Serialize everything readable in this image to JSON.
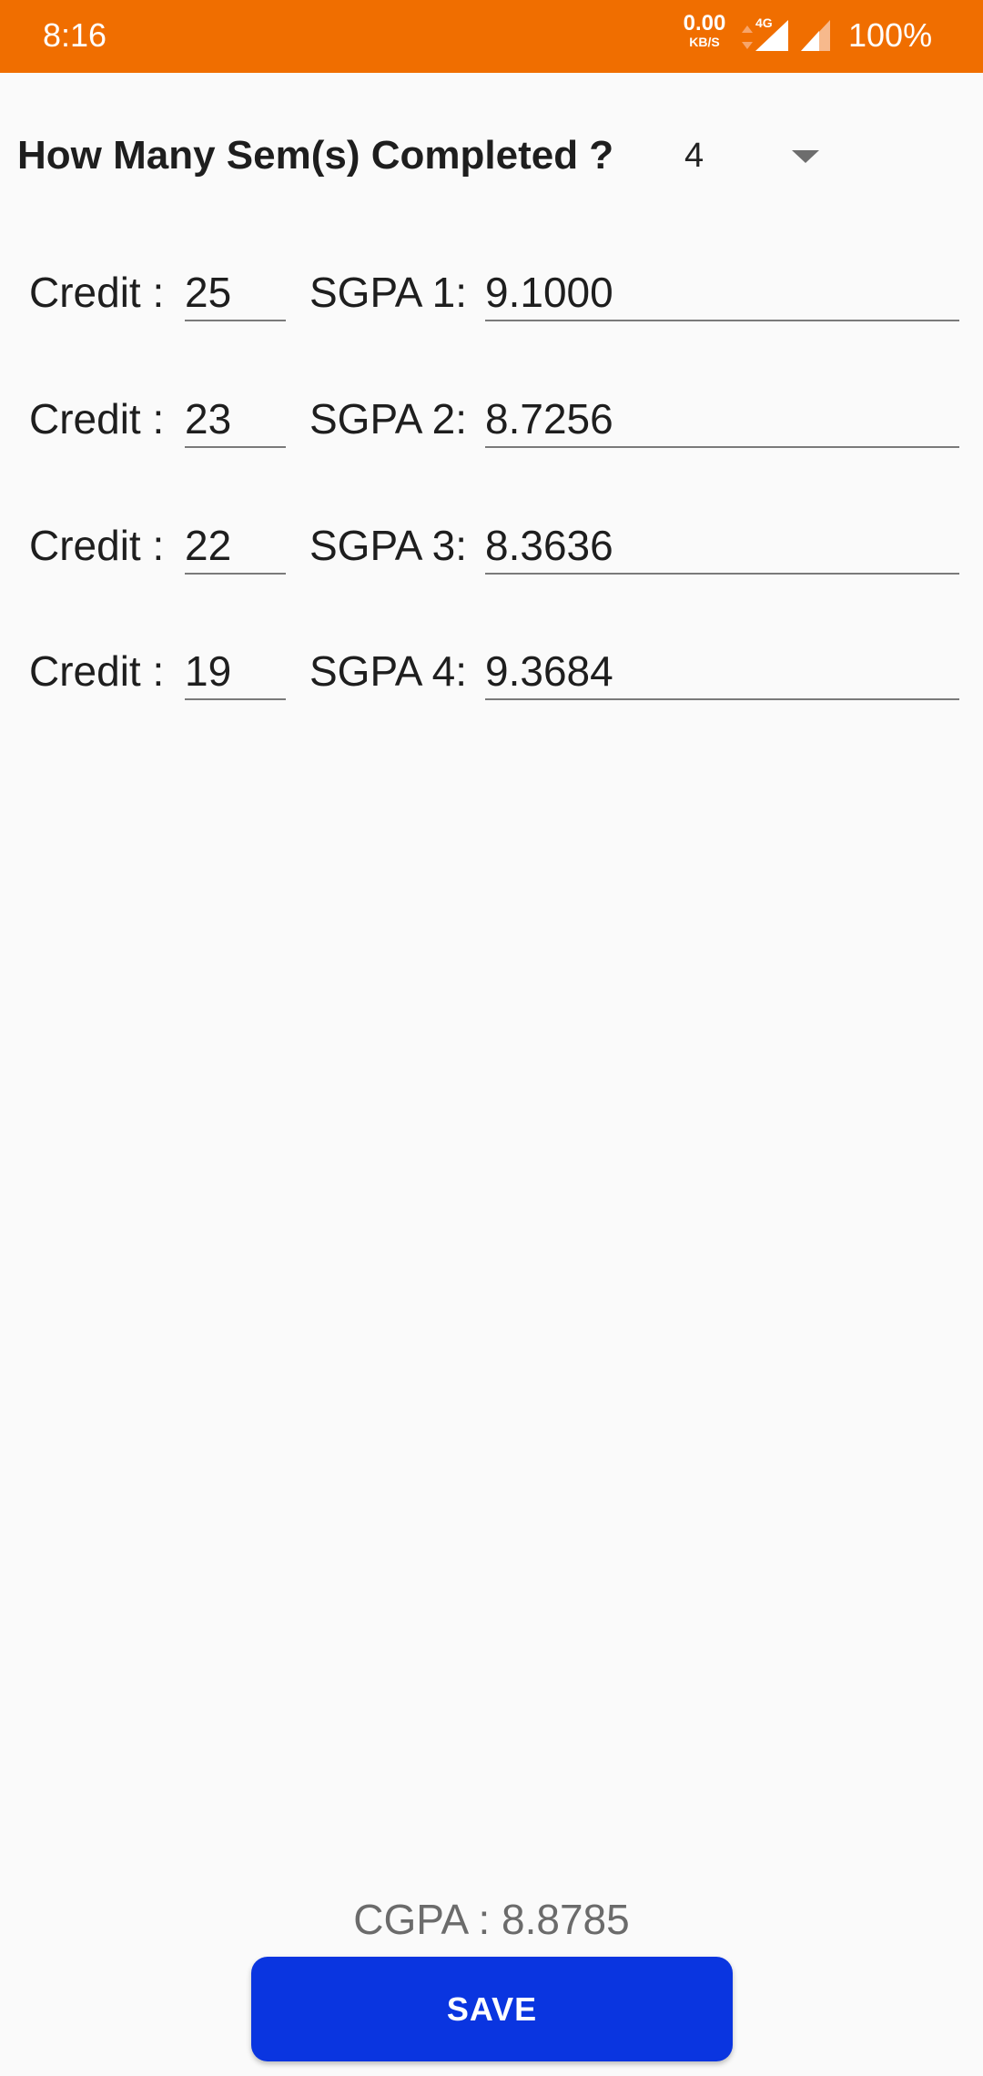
{
  "status_bar": {
    "time": "8:16",
    "net_speed_value": "0.00",
    "net_speed_unit": "KB/S",
    "network_type": "4G",
    "battery": "100%",
    "color": "#f06e00"
  },
  "header": {
    "question": "How Many Sem(s) Completed ?",
    "selected_sems": "4"
  },
  "semesters": [
    {
      "credit_label": "Credit :",
      "credit": "25",
      "sgpa_label": "SGPA 1:",
      "sgpa": "9.1000"
    },
    {
      "credit_label": "Credit :",
      "credit": "23",
      "sgpa_label": "SGPA 2:",
      "sgpa": "8.7256"
    },
    {
      "credit_label": "Credit :",
      "credit": "22",
      "sgpa_label": "SGPA 3:",
      "sgpa": "8.3636"
    },
    {
      "credit_label": "Credit :",
      "credit": "19",
      "sgpa_label": "SGPA 4:",
      "sgpa": "9.3684"
    }
  ],
  "result": {
    "cgpa_text": "CGPA : 8.8785"
  },
  "actions": {
    "save_label": "SAVE",
    "save_color": "#0a35e0"
  }
}
